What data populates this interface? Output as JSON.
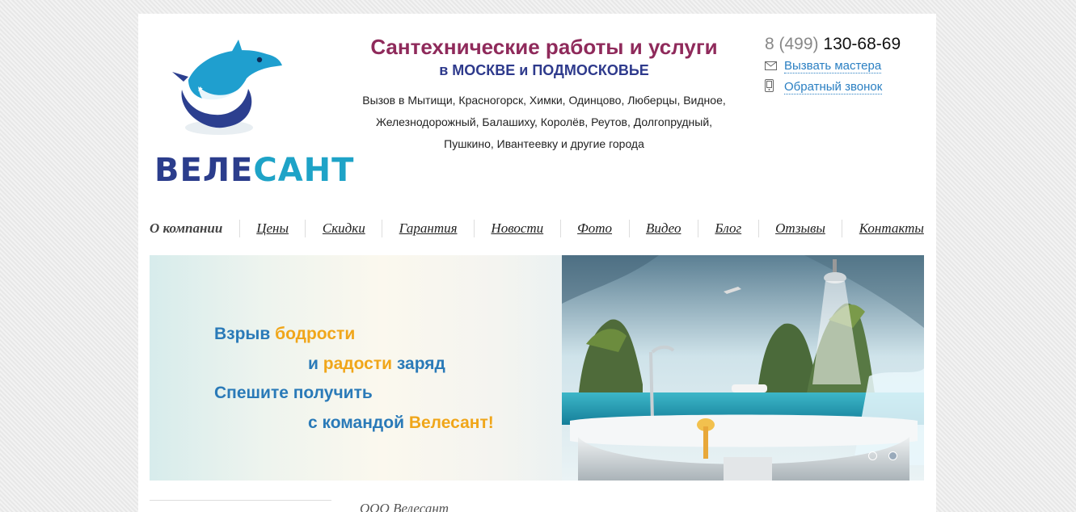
{
  "logo": {
    "text_part1": "ВЕЛЕ",
    "text_part2": "САНТ",
    "icon": "dolphin-icon"
  },
  "header": {
    "title": "Сантехнические работы и услуги",
    "subtitle": "в МОСКВЕ и ПОДМОСКОВЬЕ",
    "cities": [
      "Вызов в Мытищи, Красногорск, Химки, Одинцово, Люберцы, Видное,",
      "Железнодорожный, Балашиху, Королёв, Реутов, Долгопрудный,",
      "Пушкино, Ивантеевку и другие города"
    ]
  },
  "contacts": {
    "phone_code": "8 (499)",
    "phone_number": "130-68-69",
    "call_master": "Вызвать мастера",
    "callback": "Обратный звонок"
  },
  "menu": {
    "items": [
      "О компании",
      "Цены",
      "Скидки",
      "Гарантия",
      "Новости",
      "Фото",
      "Видео",
      "Блог",
      "Отзывы",
      "Контакты"
    ],
    "active_index": 0
  },
  "banner": {
    "line1_a": "Взрыв ",
    "line1_b": "бодрости",
    "line2_a": "и ",
    "line2_b": "радости",
    "line2_c": " заряд",
    "line3": "Спешите получить",
    "line4_a": "с командой ",
    "line4_b": "Велесант!",
    "slides_count": 2,
    "active_slide": 1
  },
  "footer": {
    "company": "ООО Велесант"
  },
  "colors": {
    "accent": "#8f2a5b",
    "navy": "#2e3a8c",
    "link": "#2a7fc2",
    "highlight": "#f0a61a"
  }
}
